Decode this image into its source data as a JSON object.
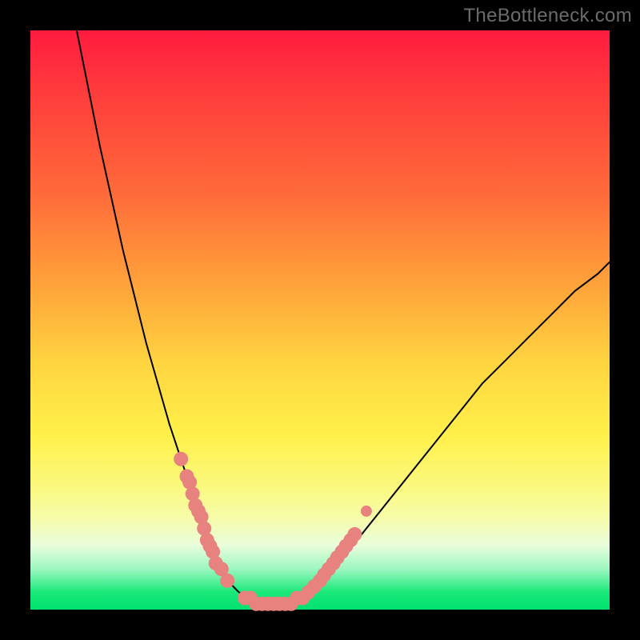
{
  "watermark": "TheBottleneck.com",
  "colors": {
    "frame": "#000000",
    "curve": "#000000",
    "marker_fill": "#e8827f",
    "marker_stroke": "#e8827f"
  },
  "chart_data": {
    "type": "line",
    "title": "",
    "xlabel": "",
    "ylabel": "",
    "xlim": [
      0,
      100
    ],
    "ylim": [
      0,
      100
    ],
    "series": [
      {
        "name": "bottleneck-curve",
        "x": [
          8,
          10,
          12,
          14,
          16,
          18,
          20,
          22,
          24,
          25,
          26,
          27,
          28,
          29,
          30,
          31,
          32,
          33,
          34,
          35,
          36,
          38,
          40,
          42,
          44,
          46,
          48,
          50,
          54,
          58,
          62,
          66,
          70,
          74,
          78,
          82,
          86,
          90,
          94,
          98,
          100
        ],
        "values": [
          100,
          90,
          80,
          71,
          62,
          54,
          46,
          39,
          32,
          29,
          26,
          23,
          20,
          17,
          14,
          11,
          9,
          7,
          5,
          4,
          3,
          2,
          1,
          1,
          1,
          2,
          3,
          5,
          9,
          14,
          19,
          24,
          29,
          34,
          39,
          43,
          47,
          51,
          55,
          58,
          60
        ]
      }
    ],
    "markers": [
      {
        "name": "left-cluster",
        "x": [
          26,
          27,
          27.5,
          28,
          28.5,
          29,
          29.5,
          30,
          30.5,
          31,
          31.5,
          32,
          33,
          34
        ],
        "y": [
          26,
          23,
          22,
          20,
          18,
          17,
          16,
          14,
          12,
          11,
          10,
          8,
          7,
          5
        ]
      },
      {
        "name": "valley-cluster",
        "x": [
          37,
          38,
          39,
          40,
          41,
          42,
          43,
          44,
          45,
          46,
          47
        ],
        "y": [
          2,
          2,
          1,
          1,
          1,
          1,
          1,
          1,
          1,
          2,
          2
        ]
      },
      {
        "name": "right-cluster",
        "x": [
          48,
          49,
          50,
          50.7,
          51.5,
          52.3,
          53,
          53.8,
          54.5,
          55.3,
          56
        ],
        "y": [
          3,
          4,
          5,
          6,
          7,
          8,
          9,
          10,
          11,
          12,
          13
        ]
      },
      {
        "name": "right-outlier",
        "x": [
          58
        ],
        "y": [
          17
        ]
      }
    ]
  }
}
